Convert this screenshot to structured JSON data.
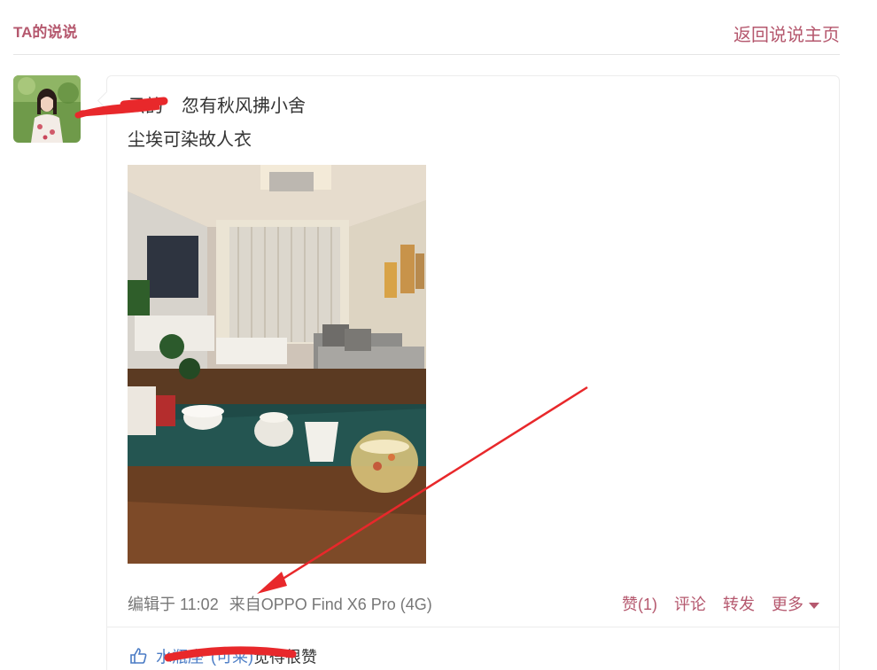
{
  "header": {
    "title": "TA的说说",
    "back_link": "返回说说主页"
  },
  "post": {
    "author": "云韵",
    "tag": "忽有秋风拂小舍",
    "text": "尘埃可染故人衣",
    "photo_icon": "living-room-photo",
    "meta": {
      "edited": "编辑于 11:02",
      "device": "来自OPPO Find X6 Pro (4G)"
    },
    "actions": {
      "like": "赞(1)",
      "comment": "评论",
      "forward": "转发",
      "more": "更多"
    },
    "likes": {
      "user": "水瓶座",
      "user_tag": "(可莱)",
      "suffix": "觉得很赞"
    }
  },
  "colors": {
    "accent": "#b5586e",
    "annotation": "#e8282b",
    "link": "#4b7cc5"
  }
}
